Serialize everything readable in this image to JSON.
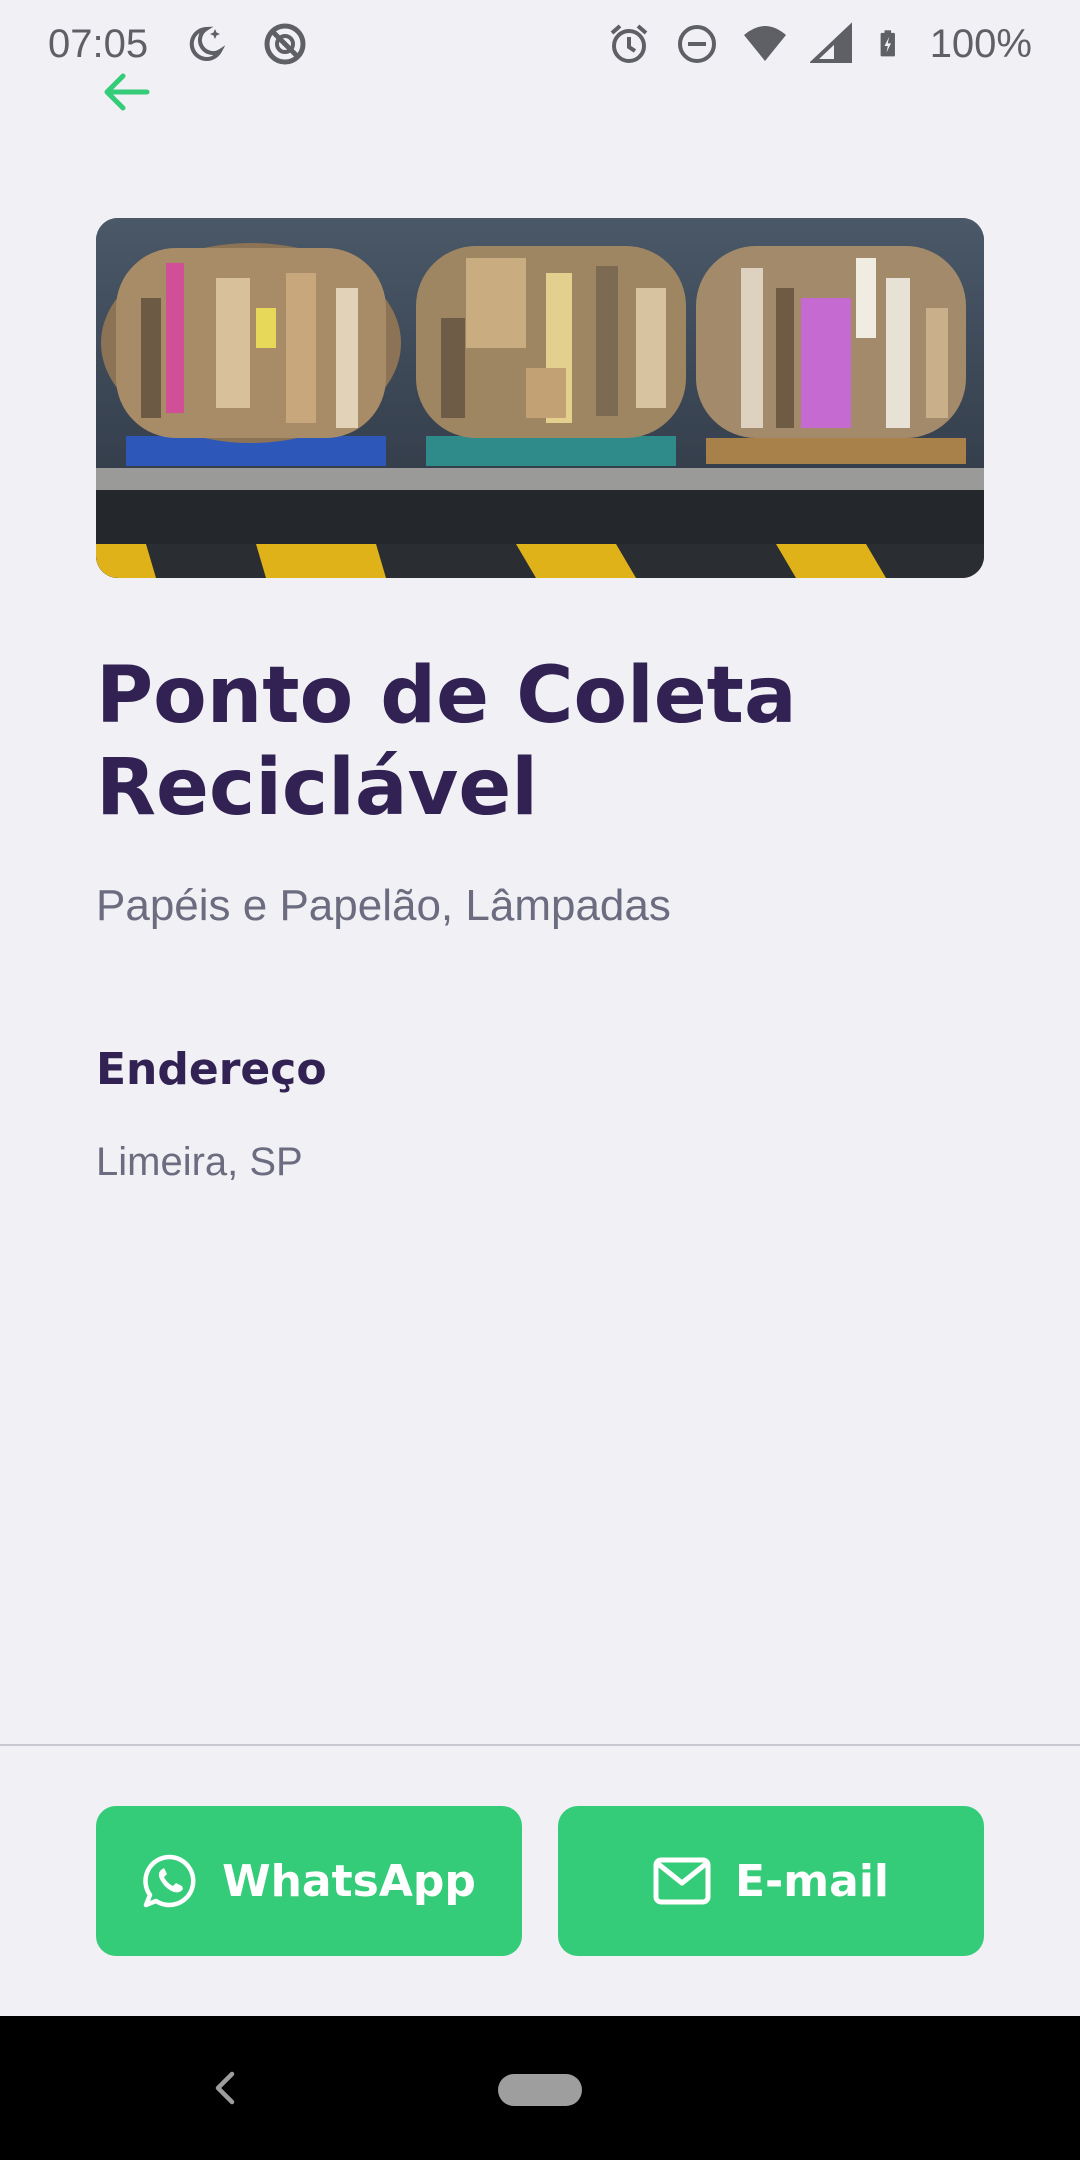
{
  "status_bar": {
    "time": "07:05",
    "battery": "100%",
    "left_icons": [
      "moon-star-icon",
      "no-disturb-ring-icon"
    ],
    "right_icons": [
      "alarm-icon",
      "do-not-disturb-icon",
      "wifi-icon",
      "signal-icon",
      "battery-charging-icon"
    ]
  },
  "header": {
    "back_icon": "arrow-left-icon"
  },
  "point": {
    "image": "cardboard-bales-photo",
    "title": "Ponto de Coleta Reciclável",
    "items": "Papéis e Papelão, Lâmpadas"
  },
  "address_section": {
    "heading": "Endereço",
    "value": "Limeira, SP"
  },
  "actions": {
    "whatsapp_label": "WhatsApp",
    "email_label": "E-mail"
  },
  "colors": {
    "accent_green": "#34cb79",
    "title_purple": "#322153",
    "text_gray": "#6c6c80",
    "background": "#f0f0f5"
  },
  "nav_bar": {
    "back_icon": "nav-back-icon",
    "home_icon": "nav-home-pill"
  }
}
